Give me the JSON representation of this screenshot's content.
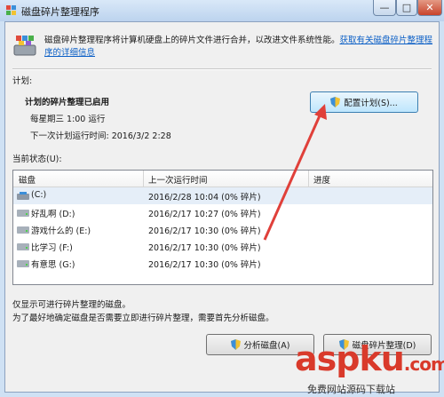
{
  "window": {
    "title": "磁盘碎片整理程序",
    "min": "—",
    "max": "□",
    "close": "✕"
  },
  "description": {
    "text": "磁盘碎片整理程序将计算机硬盘上的碎片文件进行合并，以改进文件系统性能。",
    "link": "获取有关磁盘碎片整理程序的详细信息"
  },
  "schedule": {
    "section_label": "计划:",
    "status": "计划的碎片整理已启用",
    "frequency": "每星期三  1:00 运行",
    "next_run": "下一次计划运行时间: 2016/3/2 2:28",
    "configure_button": "配置计划(S)..."
  },
  "current_status": {
    "label": "当前状态(U):",
    "columns": [
      "磁盘",
      "上一次运行时间",
      "进度"
    ],
    "rows": [
      {
        "disk": "(C:)",
        "last_run": "2016/2/28 10:04 (0% 碎片)",
        "progress": ""
      },
      {
        "disk": "好乱啊 (D:)",
        "last_run": "2016/2/17 10:27 (0% 碎片)",
        "progress": ""
      },
      {
        "disk": "游戏什么的 (E:)",
        "last_run": "2016/2/17 10:30 (0% 碎片)",
        "progress": ""
      },
      {
        "disk": "比学习 (F:)",
        "last_run": "2016/2/17 10:30 (0% 碎片)",
        "progress": ""
      },
      {
        "disk": "有意思 (G:)",
        "last_run": "2016/2/17 10:30 (0% 碎片)",
        "progress": ""
      }
    ]
  },
  "footer": {
    "note1": "仅显示可进行碎片整理的磁盘。",
    "note2": "为了最好地确定磁盘是否需要立即进行碎片整理，需要首先分析磁盘。",
    "analyze_button": "分析磁盘(A)",
    "defrag_button": "磁盘碎片整理(D)"
  },
  "watermark": {
    "text": "aspku",
    "suffix": ".com",
    "sub": "免费网站源码下载站"
  },
  "colors": {
    "accent": "#3c7fb1",
    "arrow": "#e0403a",
    "link": "#0b5fc6"
  }
}
